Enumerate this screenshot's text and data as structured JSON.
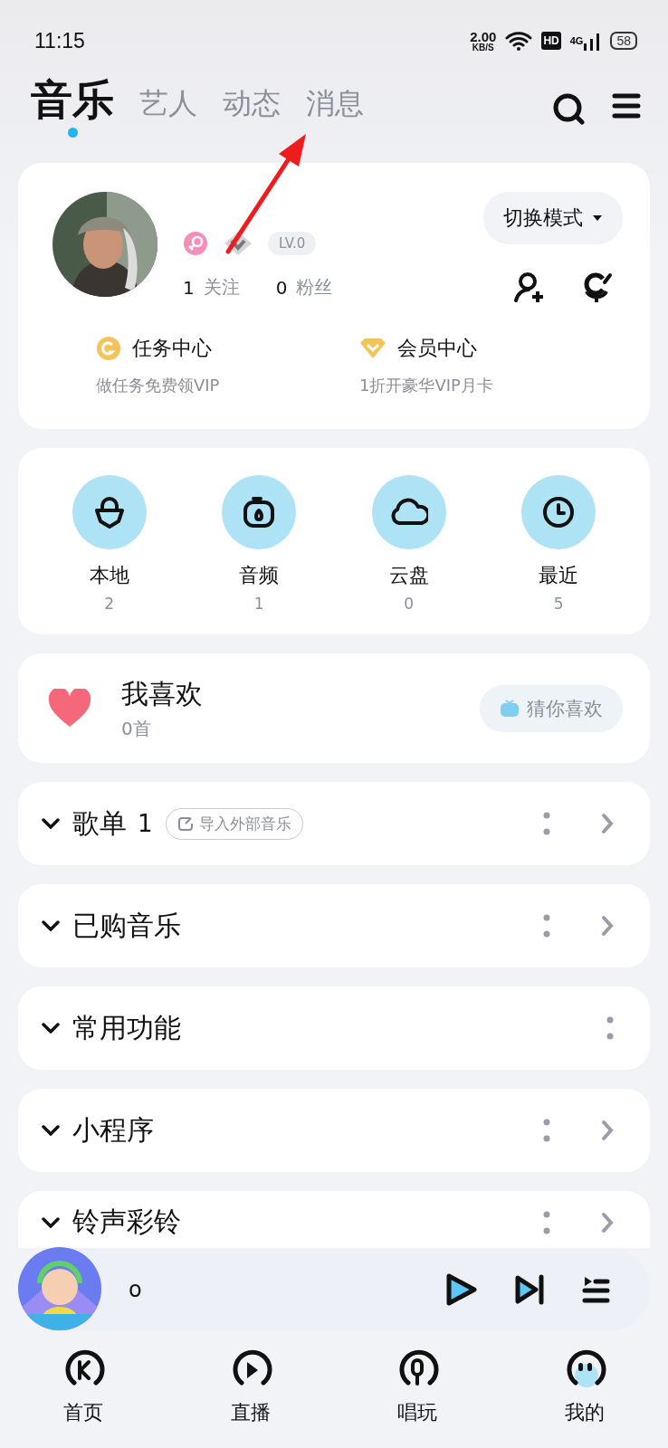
{
  "status_bar": {
    "time": "11:15",
    "speed_value": "2.00",
    "speed_unit": "KB/S",
    "hd": "HD",
    "network": "4G",
    "battery": "58"
  },
  "tabs": [
    {
      "label": "音乐",
      "selected": true
    },
    {
      "label": "艺人",
      "selected": false
    },
    {
      "label": "动态",
      "selected": false
    },
    {
      "label": "消息",
      "selected": false
    }
  ],
  "profile": {
    "level": "LV.0",
    "follow_count": "1",
    "follow_label": "关注",
    "fans_count": "0",
    "fans_label": "粉丝",
    "mode_button": "切换模式",
    "centers": [
      {
        "kind": "coin",
        "title": "任务中心",
        "subtitle": "做任务免费领VIP"
      },
      {
        "kind": "diamond",
        "title": "会员中心",
        "subtitle": "1折开豪华VIP月卡"
      }
    ]
  },
  "shortcuts": [
    {
      "kind": "local",
      "label": "本地",
      "count": "2"
    },
    {
      "kind": "audio",
      "label": "音频",
      "count": "1"
    },
    {
      "kind": "cloud",
      "label": "云盘",
      "count": "0"
    },
    {
      "kind": "recent",
      "label": "最近",
      "count": "5"
    }
  ],
  "favorites": {
    "title": "我喜欢",
    "count": "0首",
    "guess_button": "猜你喜欢"
  },
  "sections": [
    {
      "title": "歌单",
      "count": "1",
      "import_button": "导入外部音乐",
      "arrow": true
    },
    {
      "title": "已购音乐",
      "arrow": true
    },
    {
      "title": "常用功能",
      "arrow": false
    },
    {
      "title": "小程序",
      "arrow": true
    },
    {
      "title": "铃声彩铃",
      "arrow": true
    }
  ],
  "player": {
    "title": "o"
  },
  "bottom_nav": [
    {
      "kind": "home",
      "label": "首页"
    },
    {
      "kind": "live",
      "label": "直播"
    },
    {
      "kind": "sing",
      "label": "唱玩"
    },
    {
      "kind": "mine",
      "label": "我的"
    }
  ]
}
